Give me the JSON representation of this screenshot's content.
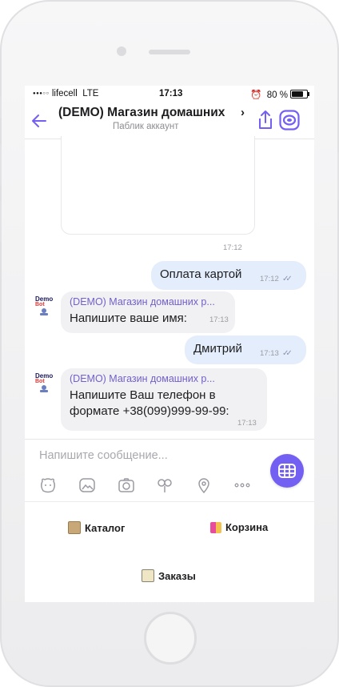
{
  "status": {
    "carrier": "lifecell",
    "network": "LTE",
    "time": "17:13",
    "battery": "80 %"
  },
  "header": {
    "title": "(DEMO) Магазин домашних",
    "chevron": "›",
    "subtitle": "Паблик аккаунт"
  },
  "messages": [
    {
      "type": "card",
      "time": "17:12"
    },
    {
      "type": "outgoing",
      "text": "Оплата картой",
      "time": "17:12"
    },
    {
      "type": "incoming",
      "sender": "(DEMO) Магазин домашних р...",
      "lines": [
        "Напишите ваше имя:"
      ],
      "time": "17:13"
    },
    {
      "type": "outgoing",
      "text": "Дмитрий",
      "time": "17:13"
    },
    {
      "type": "incoming",
      "sender": "(DEMO) Магазин домашних р...",
      "lines": [
        "Напишите Ваш телефон в",
        "формате +38(099)999-99-99:"
      ],
      "time": "17:13"
    }
  ],
  "avatar": {
    "top": "Demo",
    "bottom": "Bot"
  },
  "composer": {
    "placeholder": "Напишите сообщение..."
  },
  "tools": [
    "sticker-icon",
    "gallery-icon",
    "camera-icon",
    "doodle-icon",
    "location-icon",
    "more-icon"
  ],
  "keyboard": {
    "catalog": "Каталог",
    "cart": "Корзина",
    "orders": "Заказы"
  },
  "colors": {
    "accent": "#7360f2",
    "outgoing_bubble": "#e4edfb",
    "incoming_bubble": "#f1f1f3",
    "sender": "#7360c9"
  }
}
